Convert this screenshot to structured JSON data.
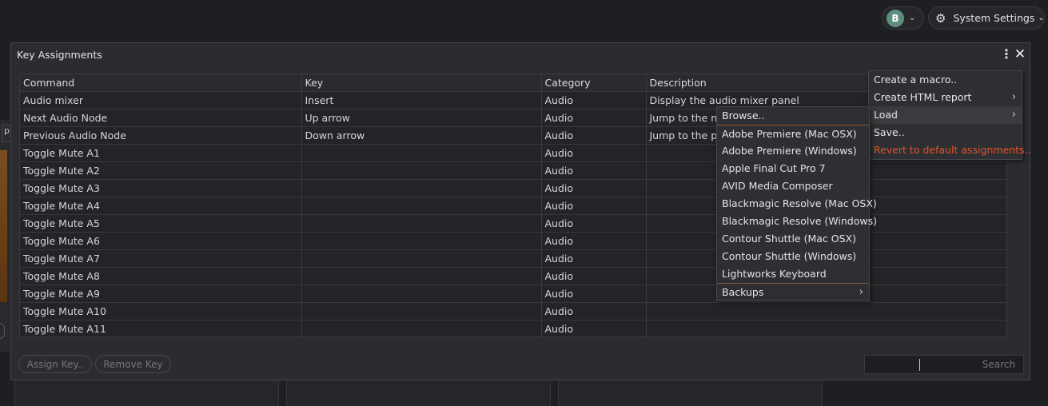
{
  "topbar": {
    "user_initial": "B",
    "settings_label": "System Settings",
    "chevron_glyph": "⌄",
    "gear_glyph": "⚙"
  },
  "background": {
    "left_tab_label": "p"
  },
  "dialog": {
    "title": "Key Assignments",
    "more_glyph": "⋮",
    "close_glyph": "✕",
    "columns": [
      "Command",
      "Key",
      "Category",
      "Description"
    ],
    "rows": [
      {
        "command": "Audio mixer",
        "key": "Insert",
        "category": "Audio",
        "description": "Display the audio mixer panel"
      },
      {
        "command": "Next Audio Node",
        "key": "Up arrow",
        "category": "Audio",
        "description": "Jump to the ne"
      },
      {
        "command": "Previous Audio Node",
        "key": "Down arrow",
        "category": "Audio",
        "description": "Jump to the pr"
      },
      {
        "command": "Toggle Mute A1",
        "key": "",
        "category": "Audio",
        "description": ""
      },
      {
        "command": "Toggle Mute A2",
        "key": "",
        "category": "Audio",
        "description": ""
      },
      {
        "command": "Toggle Mute A3",
        "key": "",
        "category": "Audio",
        "description": ""
      },
      {
        "command": "Toggle Mute A4",
        "key": "",
        "category": "Audio",
        "description": ""
      },
      {
        "command": "Toggle Mute A5",
        "key": "",
        "category": "Audio",
        "description": ""
      },
      {
        "command": "Toggle Mute A6",
        "key": "",
        "category": "Audio",
        "description": ""
      },
      {
        "command": "Toggle Mute A7",
        "key": "",
        "category": "Audio",
        "description": ""
      },
      {
        "command": "Toggle Mute A8",
        "key": "",
        "category": "Audio",
        "description": ""
      },
      {
        "command": "Toggle Mute A9",
        "key": "",
        "category": "Audio",
        "description": ""
      },
      {
        "command": "Toggle Mute A10",
        "key": "",
        "category": "Audio",
        "description": ""
      },
      {
        "command": "Toggle Mute A11",
        "key": "",
        "category": "Audio",
        "description": ""
      }
    ],
    "assign_key_label": "Assign Key..",
    "remove_key_label": "Remove Key",
    "search_placeholder": "Search"
  },
  "context_menu": {
    "items": [
      {
        "label": "Create a macro..",
        "has_submenu": false
      },
      {
        "label": "Create HTML report",
        "has_submenu": true
      },
      {
        "label": "Load",
        "has_submenu": true,
        "active": true
      },
      {
        "label": "Save..",
        "has_submenu": false
      },
      {
        "label": "Revert to default assignments..",
        "has_submenu": false,
        "danger": true
      }
    ],
    "submenu_glyph": "›"
  },
  "load_submenu": {
    "items": [
      "Browse..",
      "Adobe Premiere (Mac OSX)",
      "Adobe Premiere (Windows)",
      "Apple Final Cut Pro 7",
      "AVID Media Composer",
      "Blackmagic Resolve (Mac OSX)",
      "Blackmagic Resolve (Windows)",
      "Contour Shuttle (Mac OSX)",
      "Contour Shuttle (Windows)",
      "Lightworks Keyboard",
      "Backups"
    ]
  },
  "colors": {
    "background": "#1e1f22",
    "dialog": "#2b2c30",
    "danger": "#e2542a",
    "accent_separator": "#8a5a38"
  }
}
